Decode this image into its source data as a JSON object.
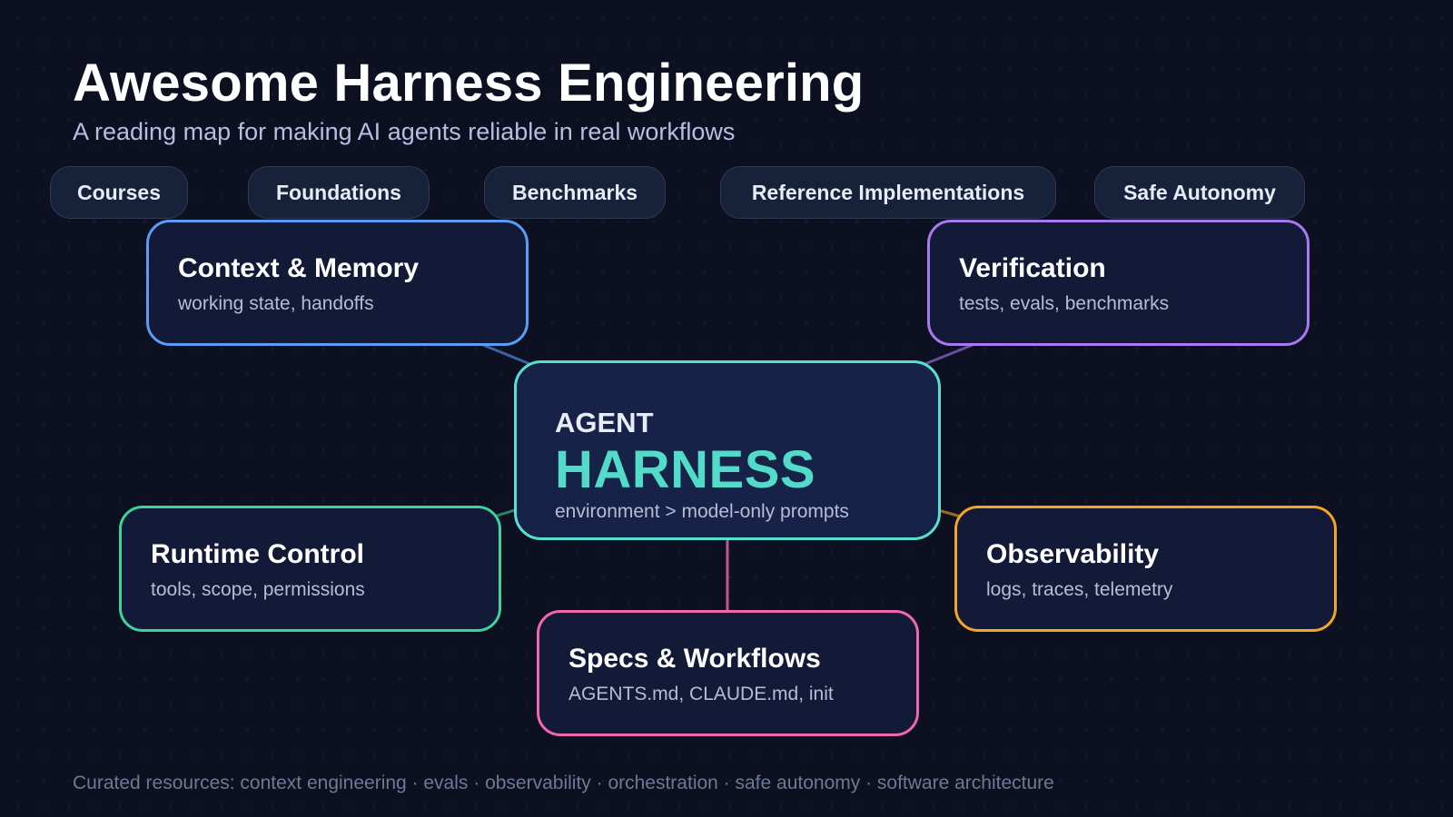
{
  "title": "Awesome Harness Engineering",
  "subtitle": "A reading map for making AI agents reliable in real workflows",
  "categories": [
    "Courses",
    "Foundations",
    "Benchmarks",
    "Reference Implementations",
    "Safe Autonomy"
  ],
  "hub": {
    "label": "AGENT",
    "title": "HARNESS",
    "description": "environment > model-only prompts",
    "color": "#58e0cf"
  },
  "nodes": {
    "context_memory": {
      "title": "Context & Memory",
      "description": "working state, handoffs",
      "color": "#5b9cf6"
    },
    "verification": {
      "title": "Verification",
      "description": "tests, evals, benchmarks",
      "color": "#a77af0"
    },
    "runtime_control": {
      "title": "Runtime Control",
      "description": "tools, scope, permissions",
      "color": "#3dd39a"
    },
    "observability": {
      "title": "Observability",
      "description": "logs, traces, telemetry",
      "color": "#f5a524"
    },
    "specs_workflows": {
      "title": "Specs & Workflows",
      "description": "AGENTS.md, CLAUDE.md, init",
      "color": "#f268b0"
    }
  },
  "footer": "Curated resources: context engineering · evals · observability · orchestration · safe autonomy · software architecture"
}
